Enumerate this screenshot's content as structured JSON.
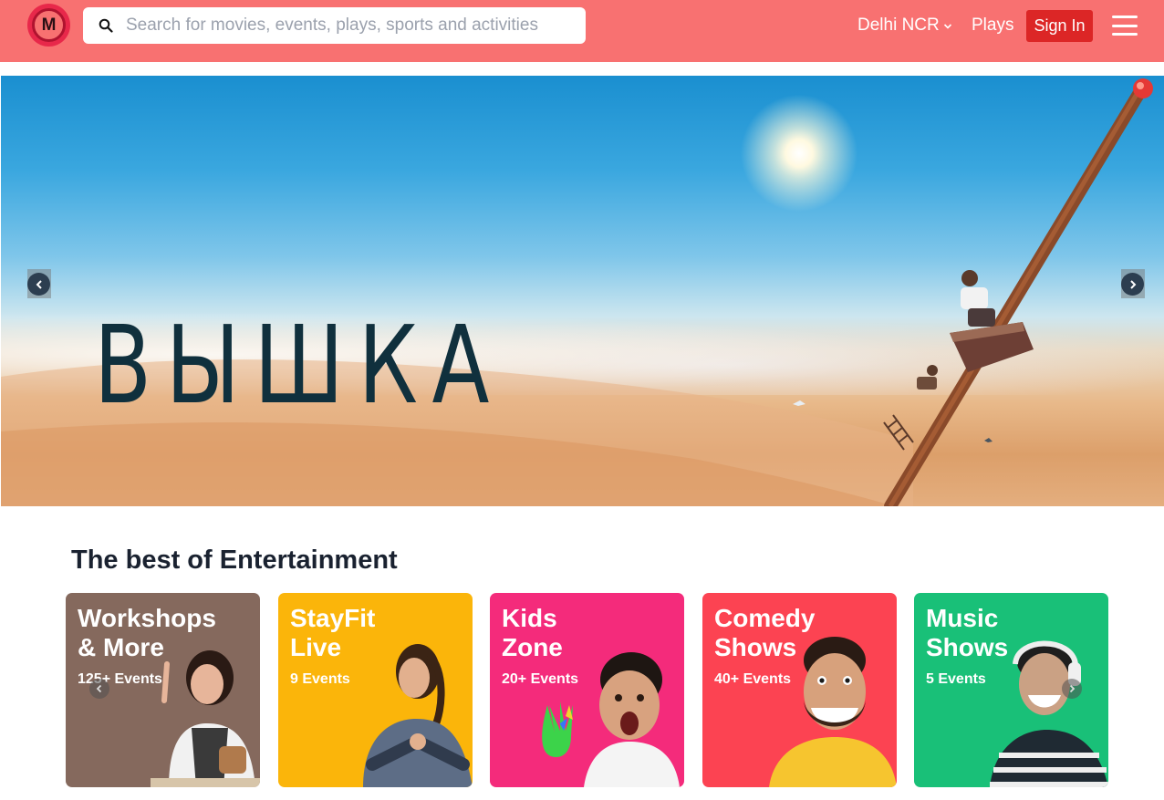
{
  "header": {
    "logo_letter": "M",
    "search": {
      "placeholder": "Search for movies, events, plays, sports and activities"
    },
    "city": "Delhi NCR",
    "plays": "Plays",
    "signin": "Sign In"
  },
  "hero": {
    "title": "ВЫШКА"
  },
  "section": {
    "title": "The best of Entertainment",
    "cards": [
      {
        "title_line1": "Workshops",
        "title_line2": "& More",
        "count": "125+ Events",
        "color": "#85695d"
      },
      {
        "title_line1": "StayFit",
        "title_line2": "Live",
        "count": "9 Events",
        "color": "#fbb50a"
      },
      {
        "title_line1": "Kids",
        "title_line2": "Zone",
        "count": "20+ Events",
        "color": "#f42b7b"
      },
      {
        "title_line1": "Comedy",
        "title_line2": "Shows",
        "count": "40+ Events",
        "color": "#fc4352"
      },
      {
        "title_line1": "Music",
        "title_line2": "Shows",
        "count": "5 Events",
        "color": "#19c078"
      }
    ]
  },
  "colors": {
    "header_bg": "#f87171",
    "signin_bg": "#dc2626"
  }
}
